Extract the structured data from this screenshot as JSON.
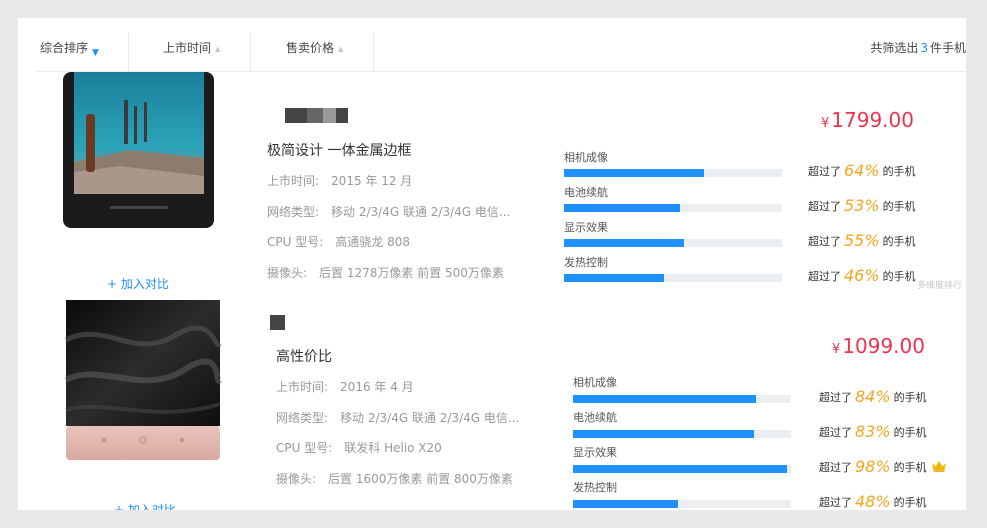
{
  "sortbar": {
    "items": [
      {
        "label": "综合排序",
        "active": true
      },
      {
        "label": "上市时间",
        "active": false
      },
      {
        "label": "售卖价格",
        "active": false
      }
    ],
    "result_prefix": "共筛选出",
    "result_count": "3",
    "result_suffix": "件手机"
  },
  "products": [
    {
      "title": "极简设计 一体金属边框",
      "price_symbol": "¥",
      "price": "1799.00",
      "compare_label": "+ 加入对比",
      "specs": [
        {
          "label": "上市时间:",
          "value": "2015 年 12 月"
        },
        {
          "label": "网络类型:",
          "value": "移动 2/3/4G 联通 2/3/4G 电信..."
        },
        {
          "label": "CPU 型号:",
          "value": "高通骁龙 808"
        },
        {
          "label": "摄像头:",
          "value": "后置 1278万像素 前置 500万像素"
        }
      ],
      "metrics": [
        {
          "label": "相机成像",
          "percent": 64,
          "prefix": "超过了",
          "pct_text": "64%",
          "suffix": "的手机"
        },
        {
          "label": "电池续航",
          "percent": 53,
          "prefix": "超过了",
          "pct_text": "53%",
          "suffix": "的手机"
        },
        {
          "label": "显示效果",
          "percent": 55,
          "prefix": "超过了",
          "pct_text": "55%",
          "suffix": "的手机"
        },
        {
          "label": "发热控制",
          "percent": 46,
          "prefix": "超过了",
          "pct_text": "46%",
          "suffix": "的手机"
        }
      ]
    },
    {
      "title": "高性价比",
      "price_symbol": "¥",
      "price": "1099.00",
      "compare_label": "+ 加入对比",
      "specs": [
        {
          "label": "上市时间:",
          "value": "2016 年 4 月"
        },
        {
          "label": "网络类型:",
          "value": "移动 2/3/4G 联通 2/3/4G 电信..."
        },
        {
          "label": "CPU 型号:",
          "value": "联发科 Helio X20"
        },
        {
          "label": "摄像头:",
          "value": "后置 1600万像素 前置 800万像素"
        }
      ],
      "metrics": [
        {
          "label": "相机成像",
          "percent": 84,
          "prefix": "超过了",
          "pct_text": "84%",
          "suffix": "的手机"
        },
        {
          "label": "电池续航",
          "percent": 83,
          "prefix": "超过了",
          "pct_text": "83%",
          "suffix": "的手机"
        },
        {
          "label": "显示效果",
          "percent": 98,
          "prefix": "超过了",
          "pct_text": "98%",
          "suffix": "的手机",
          "icon": "crown-icon"
        },
        {
          "label": "发热控制",
          "percent": 48,
          "prefix": "超过了",
          "pct_text": "48%",
          "suffix": "的手机"
        }
      ]
    }
  ],
  "watermark": "多维度排行",
  "colors": {
    "accent": "#1e90ff",
    "price": "#f0324e",
    "percent": "#f5a623",
    "crown": "#f5b800"
  }
}
